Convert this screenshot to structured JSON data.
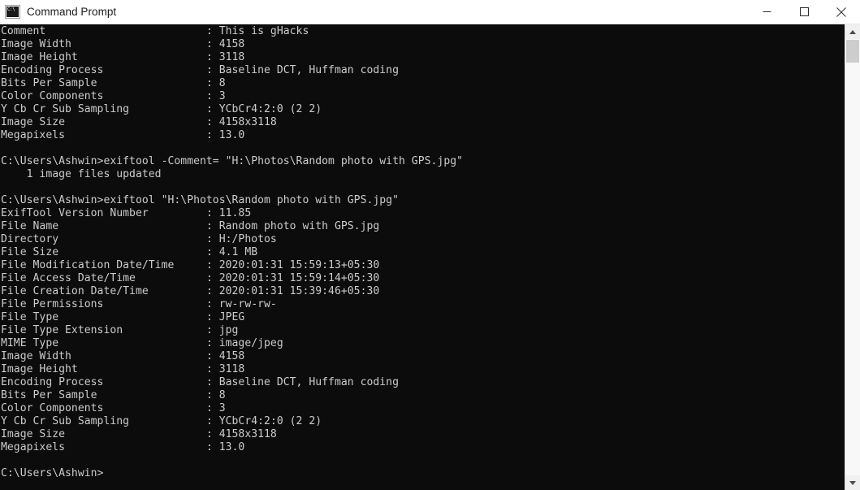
{
  "window": {
    "title": "Command Prompt",
    "icon": "console-icon",
    "icon_glyph": "C:\\",
    "colors": {
      "titlebar_bg": "#ffffff",
      "console_bg": "#0c0c0c",
      "console_fg": "#cccccc",
      "scrollbar_bg": "#f0f0f0",
      "scrollbar_thumb": "#cdcdcd"
    },
    "controls": [
      {
        "name": "minimize-button",
        "label": "Minimize"
      },
      {
        "name": "maximize-button",
        "label": "Maximize"
      },
      {
        "name": "close-button",
        "label": "Close"
      }
    ]
  },
  "scrollbar": {
    "up_arrow": "scroll-up-arrow-icon",
    "down_arrow": "scroll-down-arrow-icon",
    "thumb": "scrollbar-thumb"
  },
  "console": {
    "prompt": "C:\\Users\\Ashwin>",
    "output_text": "Comment                         : This is gHacks\nImage Width                     : 4158\nImage Height                    : 3118\nEncoding Process                : Baseline DCT, Huffman coding\nBits Per Sample                 : 8\nColor Components                : 3\nY Cb Cr Sub Sampling            : YCbCr4:2:0 (2 2)\nImage Size                      : 4158x3118\nMegapixels                      : 13.0\n\nC:\\Users\\Ashwin>exiftool -Comment= \"H:\\Photos\\Random photo with GPS.jpg\"\n    1 image files updated\n\nC:\\Users\\Ashwin>exiftool \"H:\\Photos\\Random photo with GPS.jpg\"\nExifTool Version Number         : 11.85\nFile Name                       : Random photo with GPS.jpg\nDirectory                       : H:/Photos\nFile Size                       : 4.1 MB\nFile Modification Date/Time     : 2020:01:31 15:59:13+05:30\nFile Access Date/Time           : 2020:01:31 15:59:14+05:30\nFile Creation Date/Time         : 2020:01:31 15:39:46+05:30\nFile Permissions                : rw-rw-rw-\nFile Type                       : JPEG\nFile Type Extension             : jpg\nMIME Type                       : image/jpeg\nImage Width                     : 4158\nImage Height                    : 3118\nEncoding Process                : Baseline DCT, Huffman coding\nBits Per Sample                 : 8\nColor Components                : 3\nY Cb Cr Sub Sampling            : YCbCr4:2:0 (2 2)\nImage Size                      : 4158x3118\nMegapixels                      : 13.0\n\nC:\\Users\\Ashwin>",
    "commands": [
      "exiftool -Comment= \"H:\\Photos\\Random photo with GPS.jpg\"",
      "exiftool \"H:\\Photos\\Random photo with GPS.jpg\""
    ],
    "status_messages": [
      "    1 image files updated"
    ],
    "metadata_blocks": [
      {
        "rows": [
          {
            "key": "Comment",
            "value": "This is gHacks"
          },
          {
            "key": "Image Width",
            "value": "4158"
          },
          {
            "key": "Image Height",
            "value": "3118"
          },
          {
            "key": "Encoding Process",
            "value": "Baseline DCT, Huffman coding"
          },
          {
            "key": "Bits Per Sample",
            "value": "8"
          },
          {
            "key": "Color Components",
            "value": "3"
          },
          {
            "key": "Y Cb Cr Sub Sampling",
            "value": "YCbCr4:2:0 (2 2)"
          },
          {
            "key": "Image Size",
            "value": "4158x3118"
          },
          {
            "key": "Megapixels",
            "value": "13.0"
          }
        ]
      },
      {
        "rows": [
          {
            "key": "ExifTool Version Number",
            "value": "11.85"
          },
          {
            "key": "File Name",
            "value": "Random photo with GPS.jpg"
          },
          {
            "key": "Directory",
            "value": "H:/Photos"
          },
          {
            "key": "File Size",
            "value": "4.1 MB"
          },
          {
            "key": "File Modification Date/Time",
            "value": "2020:01:31 15:59:13+05:30"
          },
          {
            "key": "File Access Date/Time",
            "value": "2020:01:31 15:59:14+05:30"
          },
          {
            "key": "File Creation Date/Time",
            "value": "2020:01:31 15:39:46+05:30"
          },
          {
            "key": "File Permissions",
            "value": "rw-rw-rw-"
          },
          {
            "key": "File Type",
            "value": "JPEG"
          },
          {
            "key": "File Type Extension",
            "value": "jpg"
          },
          {
            "key": "MIME Type",
            "value": "image/jpeg"
          },
          {
            "key": "Image Width",
            "value": "4158"
          },
          {
            "key": "Image Height",
            "value": "3118"
          },
          {
            "key": "Encoding Process",
            "value": "Baseline DCT, Huffman coding"
          },
          {
            "key": "Bits Per Sample",
            "value": "8"
          },
          {
            "key": "Color Components",
            "value": "3"
          },
          {
            "key": "Y Cb Cr Sub Sampling",
            "value": "YCbCr4:2:0 (2 2)"
          },
          {
            "key": "Image Size",
            "value": "4158x3118"
          },
          {
            "key": "Megapixels",
            "value": "13.0"
          }
        ]
      }
    ]
  }
}
